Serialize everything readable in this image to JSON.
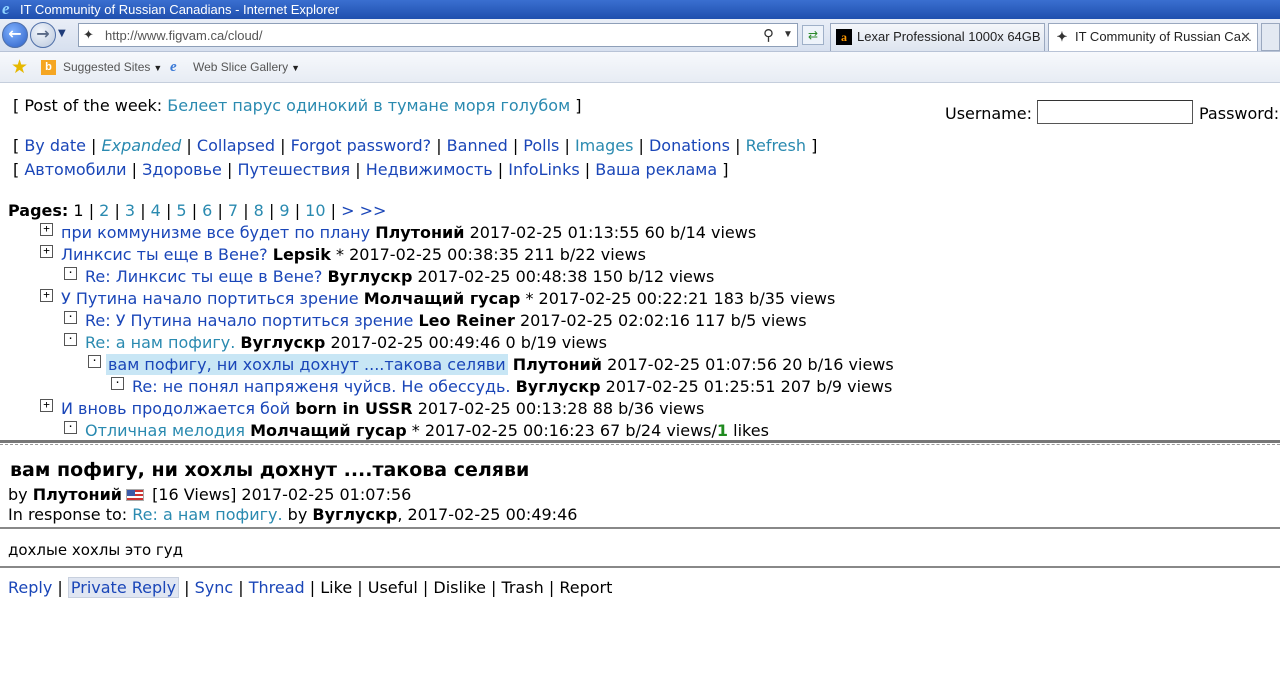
{
  "window": {
    "title": "IT Community of Russian Canadians - Internet Explorer"
  },
  "browser": {
    "address": "http://www.figvam.ca/cloud/",
    "tabs": [
      {
        "label": "Lexar Professional 1000x 64GB ..."
      },
      {
        "label": "IT Community of Russian Ca..."
      }
    ],
    "favorites": {
      "suggested": "Suggested Sites",
      "webslice": "Web Slice Gallery"
    }
  },
  "page": {
    "potw": {
      "open": "[ Post of the week:",
      "link": "Белеет парус одинокий в тумане моря голубом",
      "close": "]"
    },
    "login": {
      "username_label": "Username:",
      "password_label": "Password:"
    },
    "nav1": [
      "By date",
      "Expanded",
      "Collapsed",
      "Forgot password?",
      "Banned",
      "Polls",
      "Images",
      "Donations",
      "Refresh"
    ],
    "nav2": [
      "Автомобили",
      "Здоровье",
      "Путешествия",
      "Недвижимость",
      "InfoLinks",
      "Ваша реклама"
    ],
    "pages": {
      "label": "Pages:",
      "current": "1",
      "links": [
        "2",
        "3",
        "4",
        "5",
        "6",
        "7",
        "8",
        "9",
        "10"
      ],
      "next": "> >>"
    },
    "threads": [
      {
        "title": "при коммунизме все будет по плану",
        "author": "Плутоний",
        "meta": "2017-02-25 01:13:55 60 b/14 views"
      },
      {
        "title": "Линксис ты еще в Вене?",
        "author": "Lepsik",
        "meta": "* 2017-02-25 00:38:35 211 b/22 views"
      },
      {
        "title": "Re: Линксис ты еще в Вене?",
        "author": "Вуглускр",
        "meta": "2017-02-25 00:48:38 150 b/12 views"
      },
      {
        "title": "У Путина начало портиться зрение",
        "author": "Молчащий гусар",
        "meta": "* 2017-02-25 00:22:21 183 b/35 views"
      },
      {
        "title": "Re: У Путина начало портиться зрение",
        "author": "Leo Reiner",
        "meta": "2017-02-25 02:02:16 117 b/5 views"
      },
      {
        "title": "Re: а нам пофигу.",
        "author": "Вуглускр",
        "meta": "2017-02-25 00:49:46 0 b/19 views"
      },
      {
        "title": "вам пофигу, ни хохлы дохнут ....такова селяви",
        "author": "Плутоний",
        "meta": "2017-02-25 01:07:56 20 b/16 views"
      },
      {
        "title": "Re: не понял напряженя чуйсв. Не обессудь.",
        "author": "Вуглускр",
        "meta": "2017-02-25 01:25:51 207 b/9 views"
      },
      {
        "title": "И вновь продолжается бой",
        "author": "born in USSR",
        "meta": "2017-02-25 00:13:28 88 b/36 views"
      },
      {
        "title": "Отличная мелодия",
        "author": "Молчащий гусар",
        "meta": "* 2017-02-25 00:16:23 67 b/24 views/",
        "likes_count": "1",
        "likes_word": " likes"
      }
    ],
    "post": {
      "title": "вам пофигу, ни хохлы дохнут ....такова селяви",
      "by": "by",
      "author": "Плутоний",
      "views": "[16 Views] 2017-02-25 01:07:56",
      "inresponse_label": "In response to:",
      "inresponse_link": "Re: а нам пофигу.",
      "inresponse_by": "by",
      "inresponse_author": "Вуглускр",
      "inresponse_date": ", 2017-02-25 00:49:46",
      "body": "дохлые хохлы это гуд",
      "actions": [
        "Reply",
        "Private Reply",
        "Sync",
        "Thread",
        "Like",
        "Useful",
        "Dislike",
        "Trash",
        "Report"
      ]
    }
  }
}
